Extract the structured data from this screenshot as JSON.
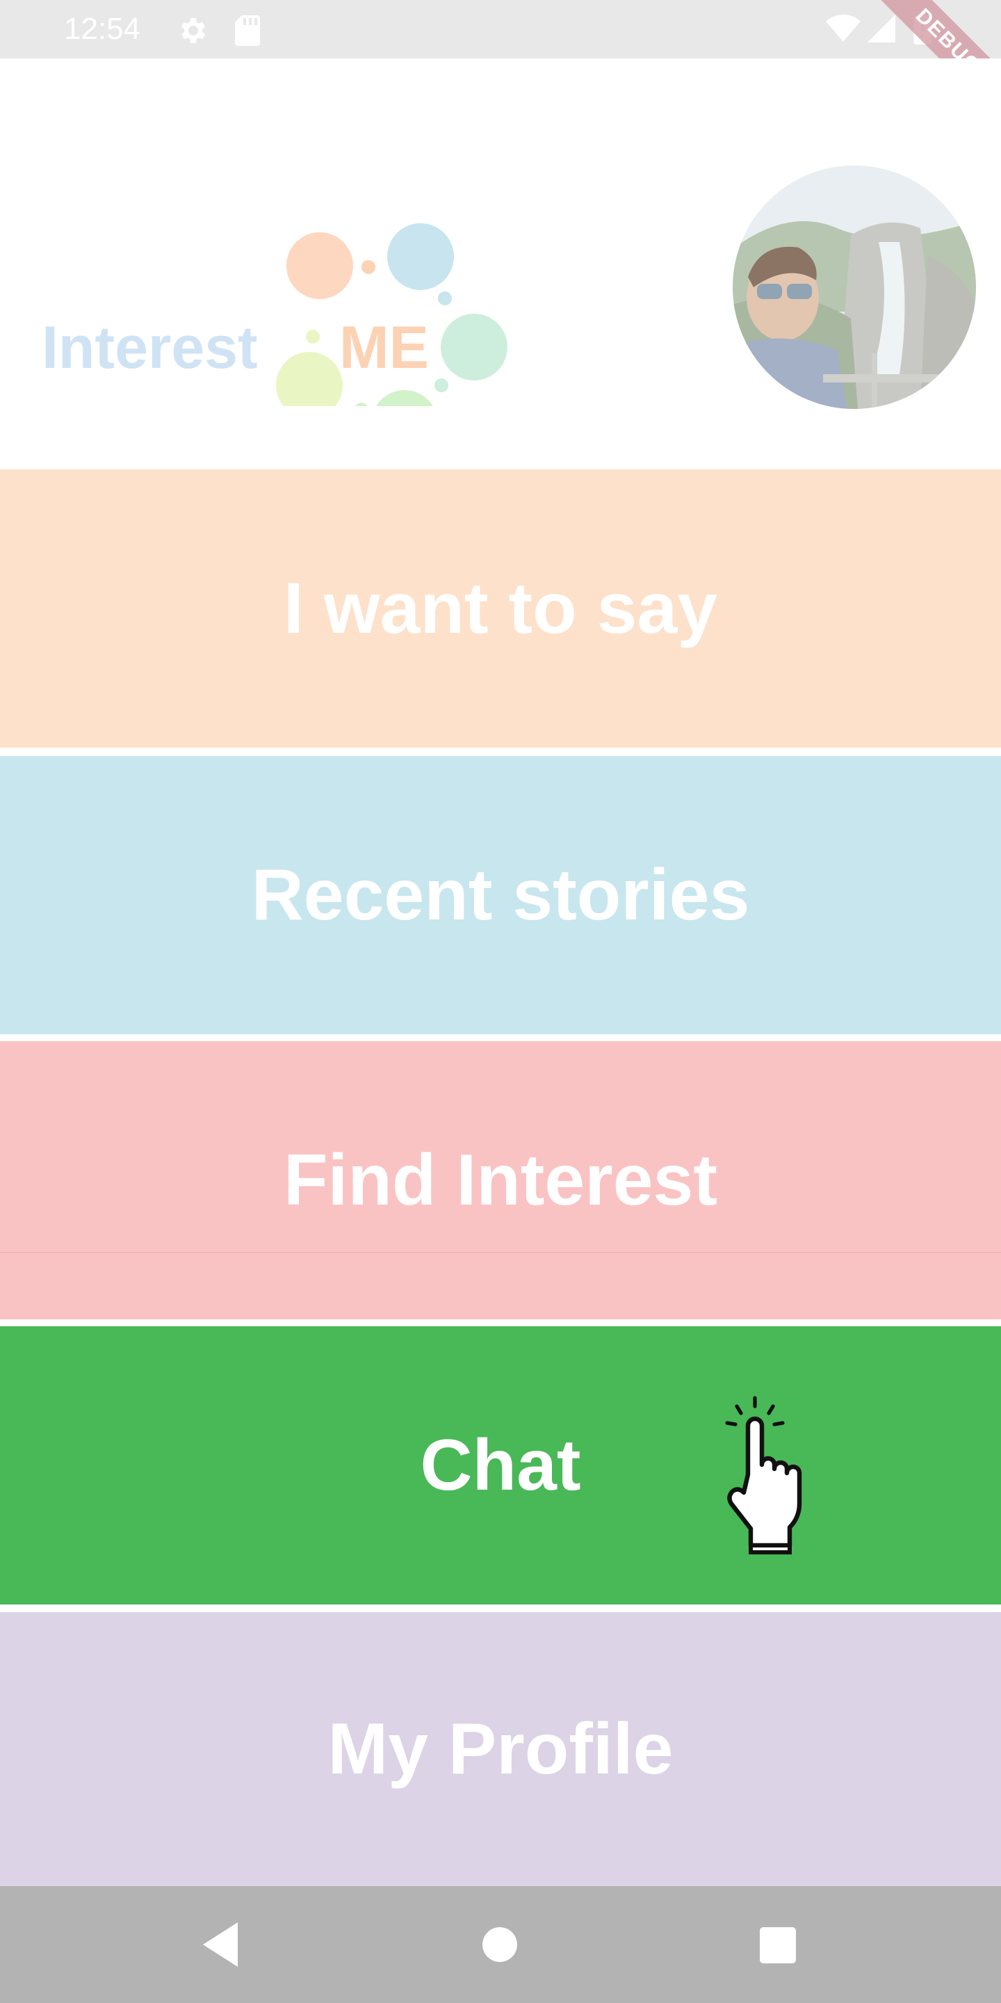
{
  "status_bar": {
    "time": "12:54",
    "icons": [
      "gear-icon",
      "sd-card-icon",
      "wifi-icon",
      "cell-signal-icon",
      "battery-icon"
    ],
    "debug_banner": "DEBUG"
  },
  "header": {
    "logo": {
      "text_interest": "Interest",
      "text_me": "ME",
      "colors": {
        "interest_text": "#cfe3f5",
        "me_text": "#fcd2b4",
        "bubble_orange": "#fdd7bf",
        "bubble_blue": "#c8e5ef",
        "bubble_mint": "#cdeedd",
        "bubble_yellow": "#eaf5c4",
        "bubble_green": "#d2f2c9"
      }
    },
    "avatar": {
      "icon": "user-photo"
    }
  },
  "menu": {
    "items": [
      {
        "label": "I want to say",
        "color": "#fde1ca"
      },
      {
        "label": "Recent stories",
        "color": "#c8e6ee"
      },
      {
        "label": "Find Interest",
        "color": "#fac3c3"
      },
      {
        "label": "Chat",
        "color": "#49b857"
      },
      {
        "label": "My Profile",
        "color": "#dcd3e6"
      }
    ]
  },
  "cursor": {
    "icon": "hand-pointer-icon"
  },
  "nav_bar": {
    "icons": [
      "back-icon",
      "home-icon",
      "recents-icon"
    ],
    "color": "#b3b3b3"
  }
}
